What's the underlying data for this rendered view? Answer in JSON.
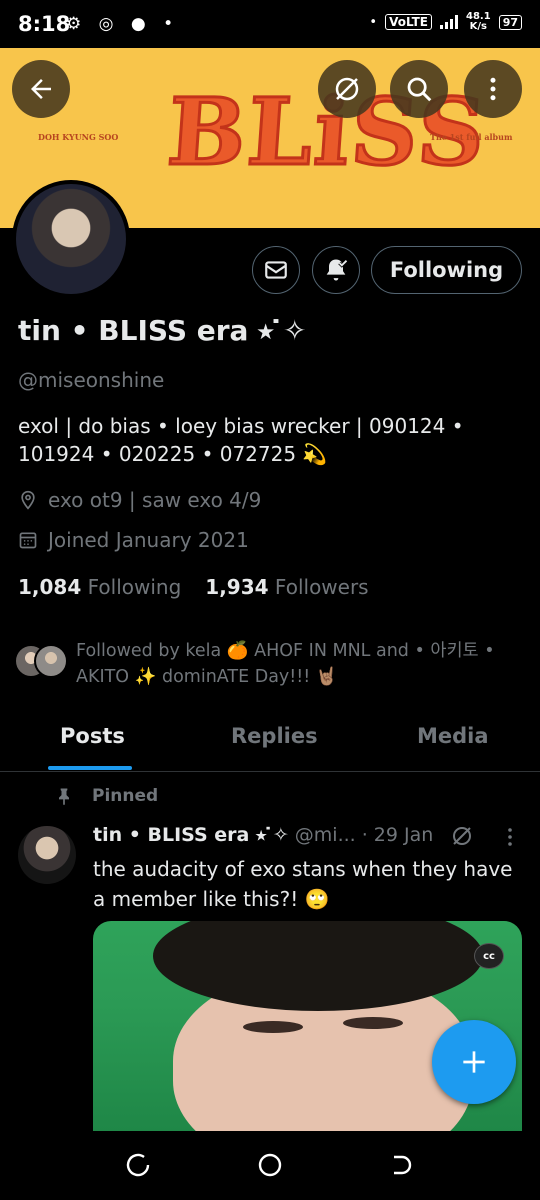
{
  "status_bar": {
    "time": "8:18",
    "icons_left": "⚙ ◎ ● •",
    "volte": "VoLTE",
    "net_speed_value": "48.1",
    "net_speed_unit": "K/s",
    "battery": "97"
  },
  "banner": {
    "title": "BLiSS",
    "artist": "DOH KYUNG SOO",
    "album": "The 1st full album",
    "bg_color": "#f8c54b"
  },
  "profile": {
    "display_name": "tin • BLISS era ⭑ ̇✧",
    "handle": "@miseonshine",
    "bio": "exol | do bias • loey bias wrecker | 090124 • 101924 • 020225 • 072725 💫",
    "location": "exo ot9 | saw exo 4/9",
    "joined": "Joined January 2021",
    "following_count": "1,084",
    "following_label": "Following",
    "followers_count": "1,934",
    "followers_label": "Followers",
    "followed_by": "Followed by kela 🍊 AHOF IN MNL and • 아키토 • AKITO ✨ dominATE Day!!! 🤘🏽",
    "following_button": "Following"
  },
  "tabs": {
    "posts": "Posts",
    "replies": "Replies",
    "media": "Media",
    "accent": "#1d9bf0"
  },
  "pinned_tweet": {
    "pinned_label": "Pinned",
    "name": "tin • BLISS era ⭑ ̇✧",
    "meta": "@mi... · 29 Jan",
    "text": "the audacity of exo stans when they have a member like this?! 🙄",
    "cc_label": "cc"
  },
  "icons": {
    "back": "arrow-left-icon",
    "grok": "grok-icon",
    "search": "search-icon",
    "more": "more-vertical-icon",
    "dm": "envelope-icon",
    "notify": "bell-check-icon",
    "location": "location-pin-icon",
    "calendar": "calendar-icon",
    "pin": "pin-icon",
    "compose": "plus-icon"
  }
}
